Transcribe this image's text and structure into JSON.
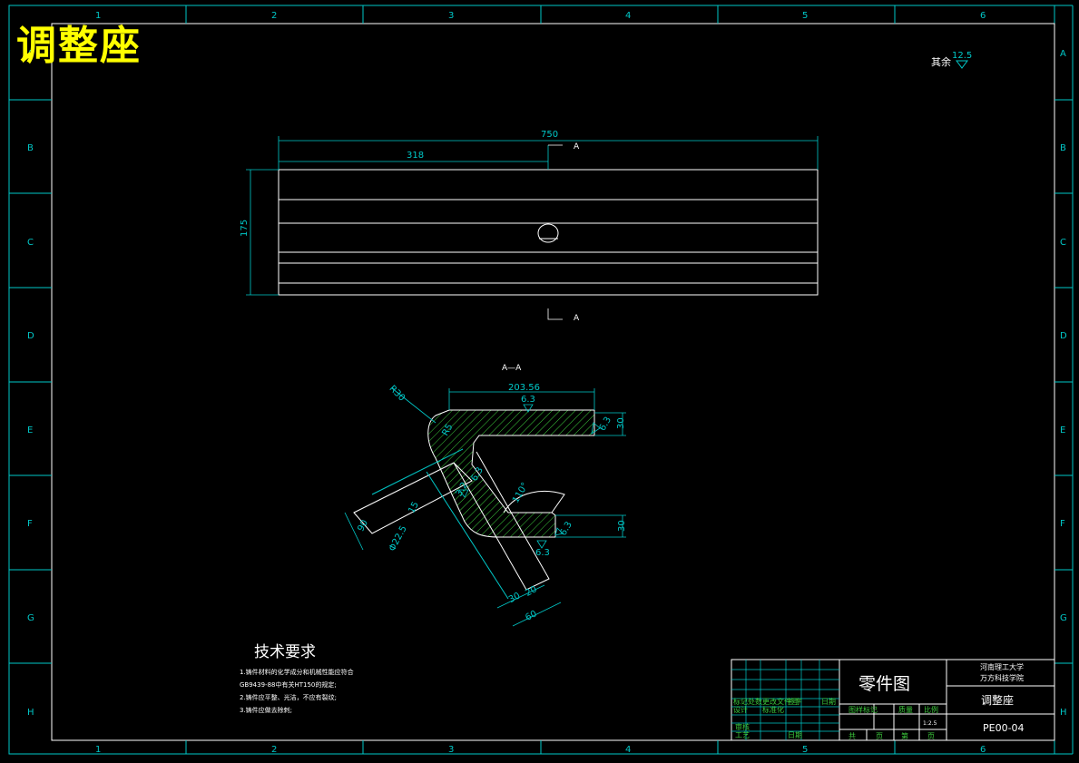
{
  "title": "调整座",
  "frame": {
    "cols": [
      "1",
      "2",
      "3",
      "4",
      "5",
      "6"
    ],
    "rows": [
      "A",
      "B",
      "C",
      "D",
      "E",
      "F",
      "G",
      "H"
    ]
  },
  "surface_note": {
    "label": "其余",
    "value": "12.5"
  },
  "top_view": {
    "dim_length": "750",
    "dim_offset": "318",
    "dim_height": "175",
    "section_mark": "A"
  },
  "section_view": {
    "label": "A—A",
    "dim_top_length": "203.56",
    "dim_radius": "R30",
    "rough_top": "6.3",
    "rough_right": "6.3",
    "rough_mid": "6.3",
    "rough_low": "6.3",
    "rough_bottom": "6.3",
    "dim_top_thick": "30",
    "dim_low_thick": "30",
    "dim_angle": "110°",
    "dim_small": "15",
    "dim_90": "90",
    "dim_hole": "Φ22.5",
    "dim_r": "R5",
    "dim_3": "3.2",
    "dim_30b": "30",
    "dim_20": "20",
    "dim_60": "60"
  },
  "tech_requirements": {
    "heading": "技术要求",
    "items": [
      "1.铸件材料的化学成分和机械性能应符合",
      "GB9439-88中有关HT150的规定;",
      "2.铸件应平整、光洁，不应有裂纹;",
      "3.铸件应做去除刺;"
    ]
  },
  "title_block": {
    "drawing_name": "零件图",
    "school_line1": "河南理工大学",
    "school_line2": "万方科技学院",
    "part_name": "调整座",
    "drawing_no": "PE00-04",
    "scale": "1:2.5",
    "h_labels": [
      "图样标记",
      "质量",
      "比例"
    ],
    "bottom_labels": [
      "共",
      "页",
      "第",
      "页"
    ],
    "left_labels": [
      "标记",
      "处数",
      "更改文件号",
      "签字",
      "日期",
      "设计",
      "标准化",
      "审核",
      "工艺",
      "日期"
    ]
  }
}
